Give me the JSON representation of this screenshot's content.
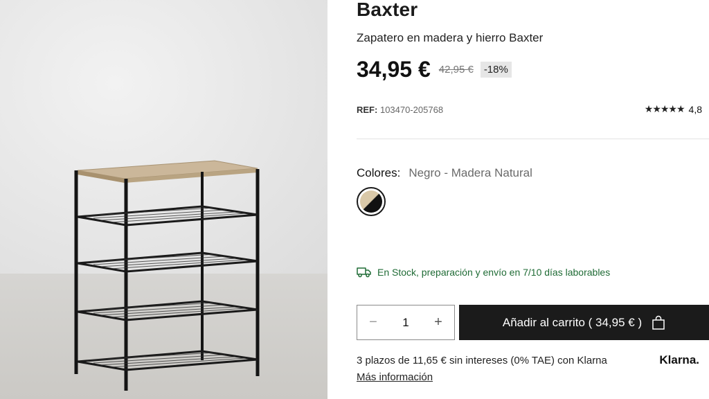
{
  "product": {
    "title": "Baxter",
    "subtitle": "Zapatero en madera y hierro Baxter",
    "price": "34,95 €",
    "old_price": "42,95 €",
    "discount": "-18%",
    "ref_label": "REF:",
    "ref_value": "103470-205768",
    "stars": "★★★★★",
    "rating": "4,8"
  },
  "colors": {
    "label": "Colores:",
    "value": "Negro - Madera Natural",
    "swatch_colors": [
      "#d9c8a8",
      "#111111"
    ]
  },
  "stock": {
    "text": "En Stock, preparación y envío en 7/10 días laborables",
    "color": "#1f6b35",
    "icon": "truck-icon"
  },
  "purchase": {
    "minus": "−",
    "quantity": "1",
    "plus": "+",
    "add_to_cart": "Añadir al carrito ( 34,95 € )",
    "cart_icon": "bag-icon"
  },
  "klarna": {
    "text": "3 plazos de 11,65 € sin intereses (0% TAE) con Klarna",
    "logo": "Klarna.",
    "more": "Más información"
  }
}
